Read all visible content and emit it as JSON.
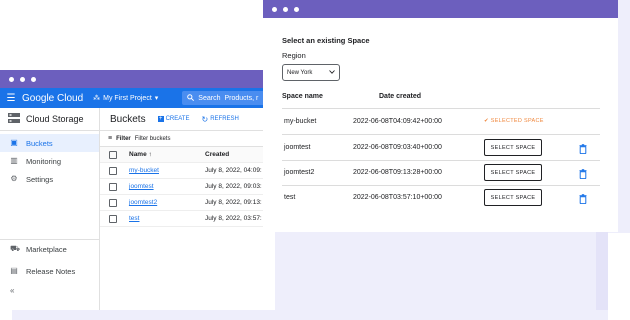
{
  "back_window": {
    "header": {
      "brand": "Google Cloud",
      "project": "My First Project",
      "search_label": "Search",
      "search_placeholder": "Products, r"
    },
    "sidebar": {
      "title": "Cloud Storage",
      "items": [
        {
          "label": "Buckets",
          "icon": "bucket-icon",
          "active": true
        },
        {
          "label": "Monitoring",
          "icon": "chart-icon",
          "active": false
        },
        {
          "label": "Settings",
          "icon": "gear-icon",
          "active": false
        }
      ],
      "bottom_items": [
        {
          "label": "Marketplace",
          "icon": "cart-icon"
        },
        {
          "label": "Release Notes",
          "icon": "notes-icon"
        }
      ]
    },
    "main": {
      "title": "Buckets",
      "create_label": "CREATE",
      "refresh_label": "REFRESH",
      "filter_label": "Filter",
      "filter_placeholder": "Filter buckets",
      "columns": {
        "name": "Name ↑",
        "created": "Created"
      },
      "rows": [
        {
          "name": "my-bucket",
          "created": "July 8, 2022, 04:09:"
        },
        {
          "name": "joomtest",
          "created": "July 8, 2022, 09:03:"
        },
        {
          "name": "joomtest2",
          "created": "July 8, 2022, 09:13:"
        },
        {
          "name": "test",
          "created": "July 8, 2022, 03:57:"
        }
      ]
    }
  },
  "front_window": {
    "title": "Select an existing Space",
    "region_label": "Region",
    "region_value": "New York",
    "columns": {
      "name": "Space name",
      "date": "Date created"
    },
    "select_label": "SELECT SPACE",
    "selected_label": "✔ SELECTED SPACE",
    "rows": [
      {
        "name": "my-bucket",
        "date": "2022-06-08T04:09:42+00:00",
        "selected": true
      },
      {
        "name": "joomtest",
        "date": "2022-06-08T09:03:40+00:00",
        "selected": false
      },
      {
        "name": "joomtest2",
        "date": "2022-06-08T09:13:28+00:00",
        "selected": false
      },
      {
        "name": "test",
        "date": "2022-06-08T03:57:10+00:00",
        "selected": false
      }
    ]
  },
  "colors": {
    "titlebar": "#6c5fbe",
    "gc_blue": "#1a73e8",
    "accent_orange": "#f0883e",
    "backdrop": "#eeeefb"
  }
}
